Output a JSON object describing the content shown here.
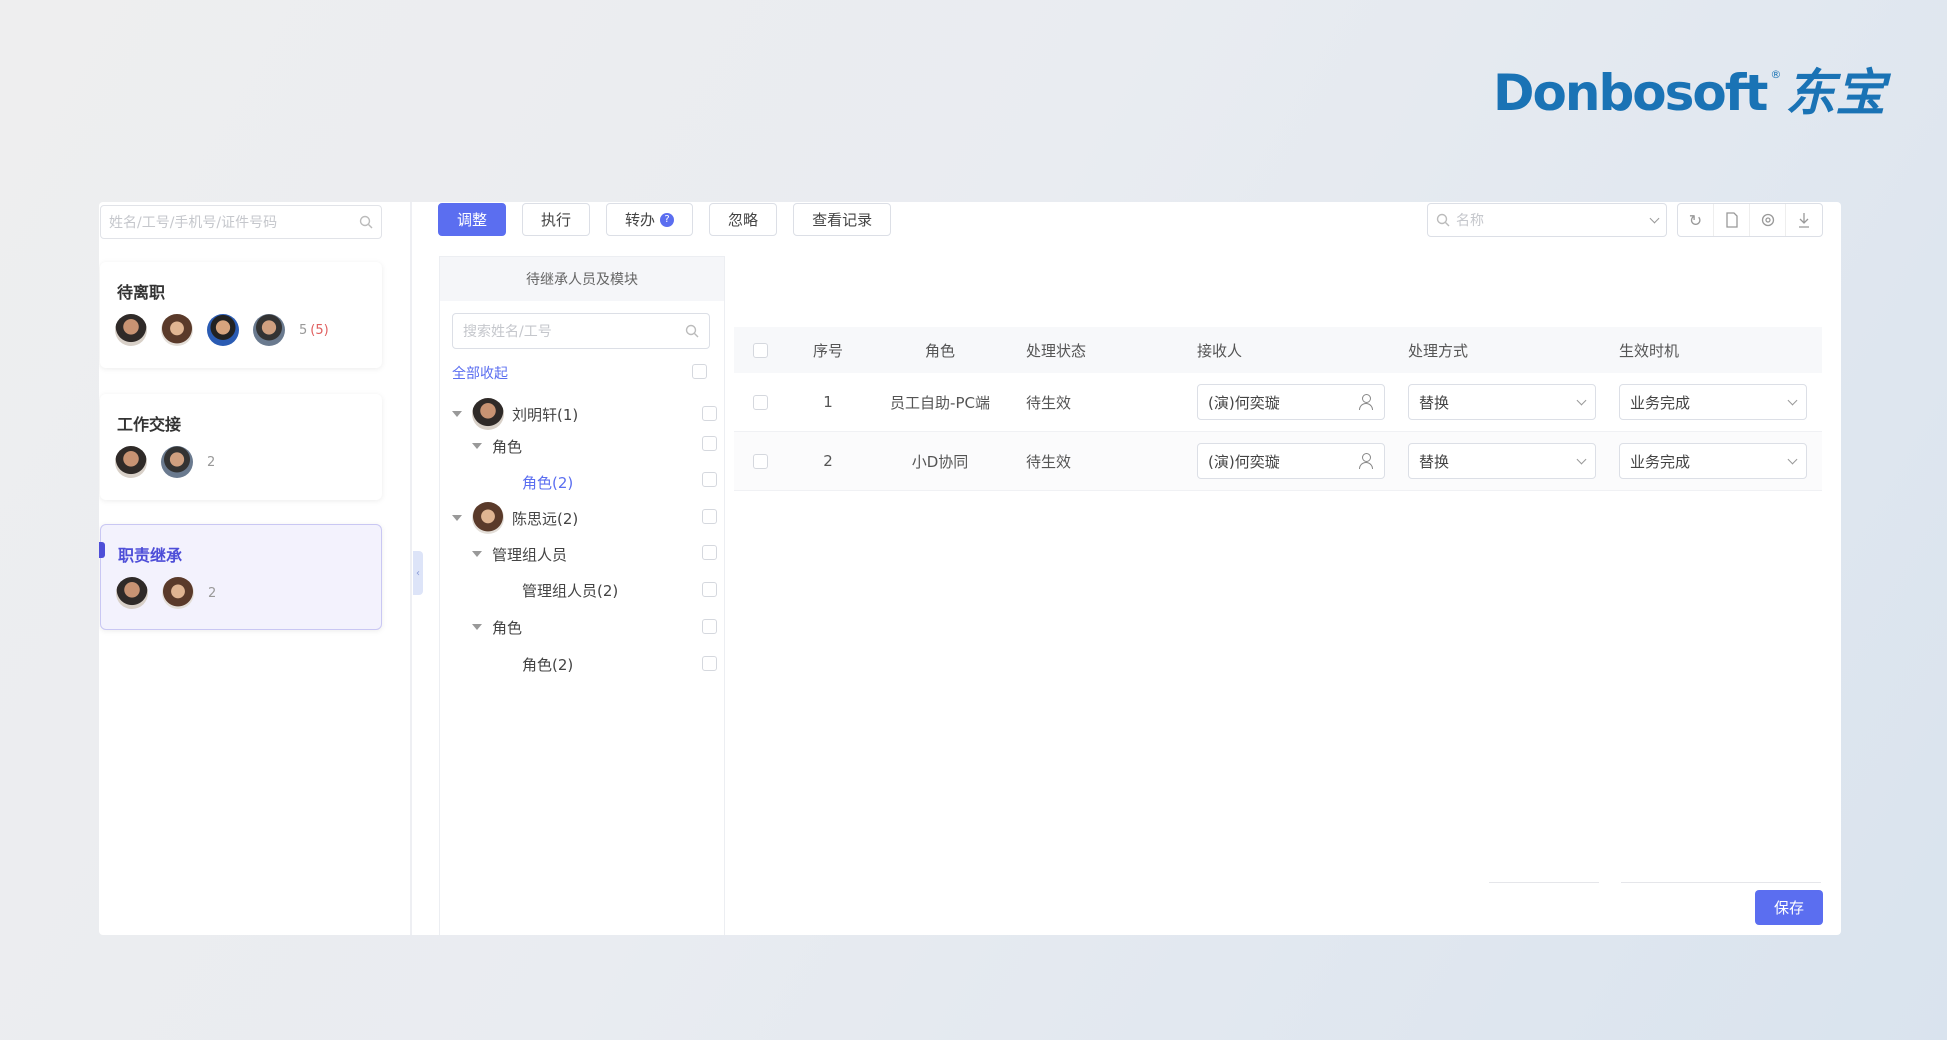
{
  "logo": {
    "brand": "Donbosoft",
    "reg": "®",
    "cn": "东宝"
  },
  "left": {
    "search_placeholder": "姓名/工号/手机号/证件号码",
    "cards": [
      {
        "title": "待离职",
        "count": "5",
        "count_red": "(5)"
      },
      {
        "title": "工作交接",
        "count": "2"
      },
      {
        "title": "职责继承",
        "count": "2"
      }
    ]
  },
  "toolbar": {
    "adjust": "调整",
    "execute": "执行",
    "transfer": "转办",
    "help_mark": "?",
    "ignore": "忽略",
    "view_records": "查看记录",
    "name_placeholder": "名称"
  },
  "tree": {
    "header": "待继承人员及模块",
    "search_placeholder": "搜索姓名/工号",
    "collapse_all": "全部收起",
    "nodes": [
      {
        "label": "刘明轩(1)"
      },
      {
        "label": "角色"
      },
      {
        "label": "角色(2)"
      },
      {
        "label": "陈思远(2)"
      },
      {
        "label": "管理组人员"
      },
      {
        "label": "管理组人员(2)"
      },
      {
        "label": "角色"
      },
      {
        "label": "角色(2)"
      }
    ]
  },
  "table": {
    "headers": {
      "seq": "序号",
      "role": "角色",
      "status": "处理状态",
      "receiver": "接收人",
      "method": "处理方式",
      "time": "生效时机"
    },
    "rows": [
      {
        "seq": "1",
        "role": "员工自助-PC端",
        "status": "待生效",
        "receiver": "(演)何奕璇",
        "method": "替换",
        "time": "业务完成"
      },
      {
        "seq": "2",
        "role": "小D协同",
        "status": "待生效",
        "receiver": "(演)何奕璇",
        "method": "替换",
        "time": "业务完成"
      }
    ]
  },
  "save": "保存",
  "colors": {
    "primary": "#5b6ef0",
    "logo": "#1a73b5"
  }
}
